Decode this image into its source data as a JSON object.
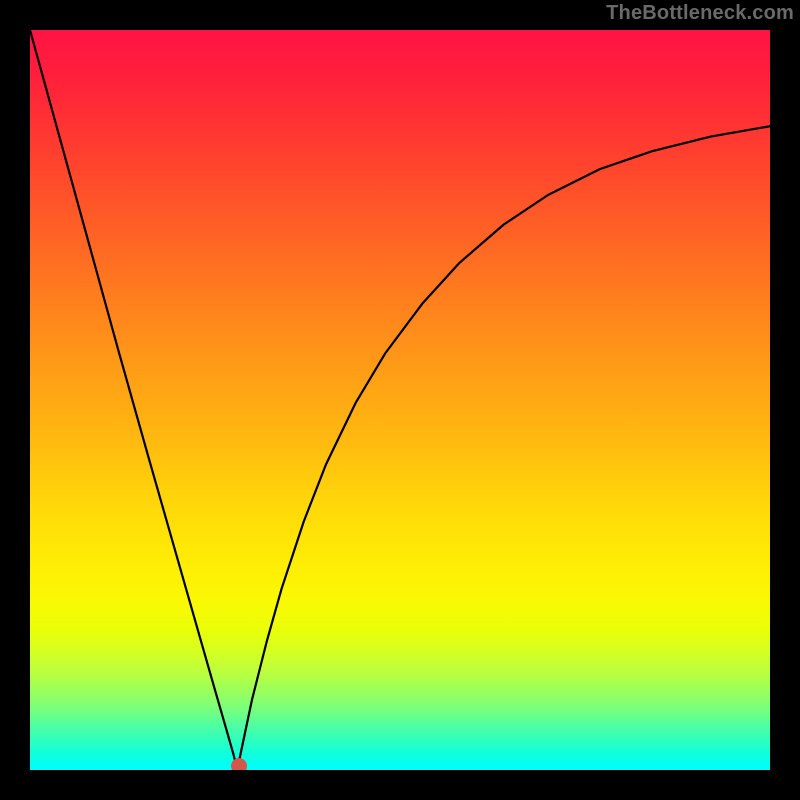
{
  "watermark": "TheBottleneck.com",
  "chart_data": {
    "type": "line",
    "title": "",
    "xlabel": "",
    "ylabel": "",
    "xlim": [
      0,
      100
    ],
    "ylim": [
      0,
      100
    ],
    "grid": false,
    "legend": false,
    "description": "Bottleneck percentage curve over a rainbow vertical gradient; minimum marked with a red dot near x≈28.",
    "series": [
      {
        "name": "bottleneck-curve",
        "x": [
          0,
          4,
          8,
          12,
          16,
          20,
          23,
          25,
          26.5,
          27.5,
          28,
          28.5,
          30,
          32,
          34,
          37,
          40,
          44,
          48,
          53,
          58,
          64,
          70,
          77,
          84,
          92,
          100
        ],
        "y": [
          100,
          85.5,
          71,
          56.5,
          42.3,
          28.3,
          17.8,
          10.8,
          5.6,
          2.1,
          0,
          2.4,
          9.5,
          17.4,
          24.5,
          33.6,
          41.3,
          49.6,
          56.3,
          63,
          68.5,
          73.7,
          77.7,
          81.2,
          83.6,
          85.6,
          87
        ],
        "color": "#000000",
        "width": 2.2
      }
    ],
    "marker": {
      "x": 28.2,
      "y": 0.5,
      "color": "#d4564a"
    },
    "background_gradient": {
      "direction": "top-to-bottom",
      "stops": [
        {
          "pos": 0.0,
          "color": "#ff1444"
        },
        {
          "pos": 0.5,
          "color": "#ffb810"
        },
        {
          "pos": 0.78,
          "color": "#fbf803"
        },
        {
          "pos": 1.0,
          "color": "#00fffe"
        }
      ]
    }
  }
}
